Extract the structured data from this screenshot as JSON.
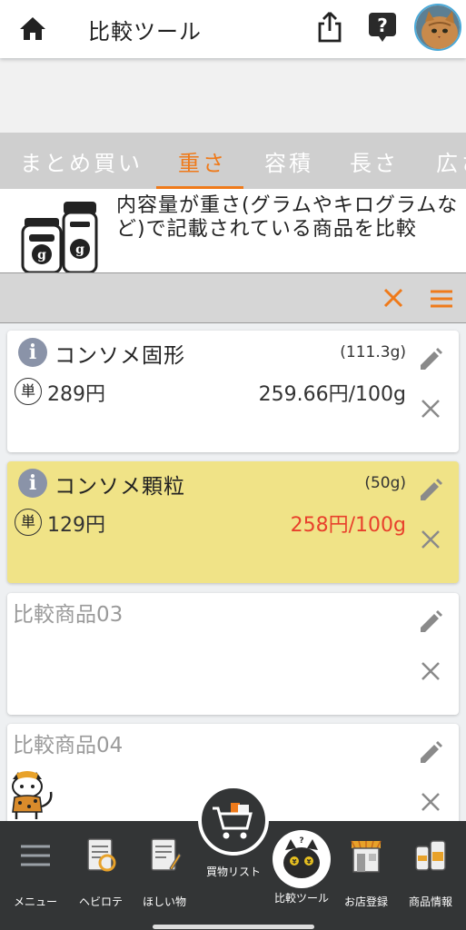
{
  "header": {
    "title": "比較ツール"
  },
  "tabs": [
    "まとめ買い",
    "重さ",
    "容積",
    "長さ",
    "広さ"
  ],
  "active_tab": "重さ",
  "banner": {
    "text": "内容量が重さ(グラムやキログラムなど)で記載されている商品を比較"
  },
  "products": [
    {
      "name": "コンソメ固形",
      "quantity": "(111.3g)",
      "unit_badge": "単",
      "price": "289円",
      "per_unit": "259.66円/100g",
      "cheapest": false
    },
    {
      "name": "コンソメ顆粒",
      "quantity": "(50g)",
      "unit_badge": "単",
      "price": "129円",
      "per_unit": "258円/100g",
      "cheapest": true
    },
    {
      "placeholder": "比較商品03"
    },
    {
      "placeholder": "比較商品04"
    }
  ],
  "bottom_nav": {
    "menu": "メニュー",
    "hebirote": "ヘビロテ",
    "wishlist": "ほしい物",
    "shopping_list": "買物リスト",
    "compare": "比較ツール",
    "store": "お店登録",
    "product_info": "商品情報"
  },
  "colors": {
    "accent": "#ef7a1a",
    "cheap": "#e8412c",
    "highlight": "#f0e387",
    "nav_bg": "#333536"
  }
}
